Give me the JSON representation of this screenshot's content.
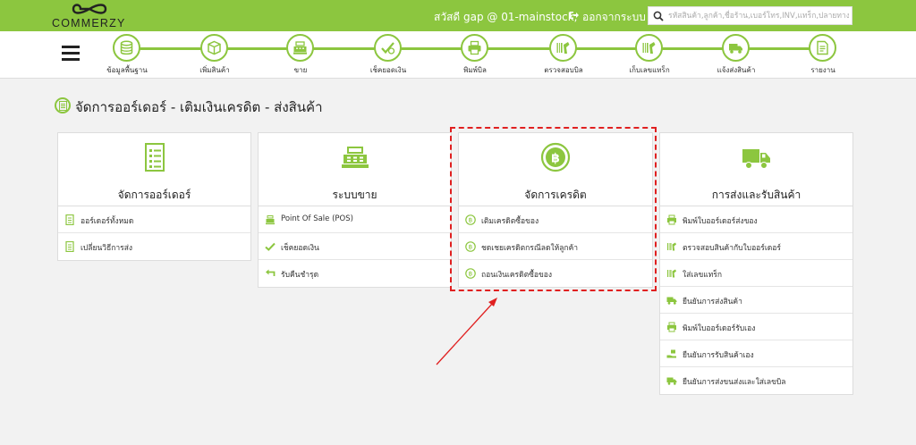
{
  "brand": {
    "name": "COMMERZY"
  },
  "header": {
    "greeting": "สวัสดี gap @ 01-mainstock,",
    "logout": "ออกจากระบบ",
    "search_placeholder": "รหัสสินค้า,ลูกค้า,ชื่อร้าน,เบอร์โทร,INV,แทร็ก,ปลายทาง"
  },
  "nav": {
    "steps": [
      {
        "label": "ข้อมูลพื้นฐาน",
        "icon": "database-icon"
      },
      {
        "label": "เพิ่มสินค้า",
        "icon": "box-icon"
      },
      {
        "label": "ขาย",
        "icon": "cash-register-icon"
      },
      {
        "label": "เช็คยอดเงิน",
        "icon": "check-money-icon"
      },
      {
        "label": "พิมพ์บิล",
        "icon": "printer-icon"
      },
      {
        "label": "ตรวจสอบบิล",
        "icon": "barcode-scan-icon"
      },
      {
        "label": "เก็บเลขแทร็ก",
        "icon": "barcode-scan-icon"
      },
      {
        "label": "แจ้งส่งสินค้า",
        "icon": "truck-icon"
      },
      {
        "label": "รายงาน",
        "icon": "report-icon"
      }
    ]
  },
  "page": {
    "title": "จัดการออร์เดอร์ - เติมเงินเครดิต - ส่งสินค้า"
  },
  "cards": [
    {
      "title": "จัดการออร์เดอร์",
      "icon": "document-list-icon",
      "items": [
        {
          "label": "ออร์เดอร์ทั้งหมด",
          "icon": "document-icon"
        },
        {
          "label": "เปลี่ยนวิธีการส่ง",
          "icon": "document-icon"
        }
      ]
    },
    {
      "title": "ระบบขาย",
      "icon": "cash-register-icon",
      "items": [
        {
          "label": "Point Of Sale (POS)",
          "icon": "cash-register-icon"
        },
        {
          "label": "เช็คยอดเงิน",
          "icon": "check-icon"
        },
        {
          "label": "รับคืนชำรุด",
          "icon": "return-icon"
        }
      ]
    },
    {
      "title": "จัดการเครดิต",
      "icon": "baht-coin-icon",
      "items": [
        {
          "label": "เติมเครดิตซื้อของ",
          "icon": "baht-coin-icon"
        },
        {
          "label": "ชดเชยเครดิตกรณีลดให้ลูกค้า",
          "icon": "baht-coin-icon"
        },
        {
          "label": "ถอนเงินเครดิตซื้อของ",
          "icon": "baht-coin-icon"
        }
      ]
    },
    {
      "title": "การส่งและรับสินค้า",
      "icon": "truck-icon",
      "items": [
        {
          "label": "พิมพ์ใบออร์เดอร์ส่งของ",
          "icon": "printer-icon"
        },
        {
          "label": "ตรวจสอบสินค้ากับใบออร์เดอร์",
          "icon": "barcode-scan-icon"
        },
        {
          "label": "ใส่เลขแทร็ก",
          "icon": "barcode-scan-icon"
        },
        {
          "label": "ยืนยันการส่งสินค้า",
          "icon": "truck-icon"
        },
        {
          "label": "พิมพ์ใบออร์เดอร์รับเอง",
          "icon": "printer-icon"
        },
        {
          "label": "ยืนยันการรับสินค้าเอง",
          "icon": "hand-box-icon"
        },
        {
          "label": "ยืนยันการส่งขนส่งและใส่เลขบิล",
          "icon": "truck-icon"
        }
      ]
    }
  ],
  "colors": {
    "accent": "#8cc63f",
    "annotation": "#e02020"
  }
}
